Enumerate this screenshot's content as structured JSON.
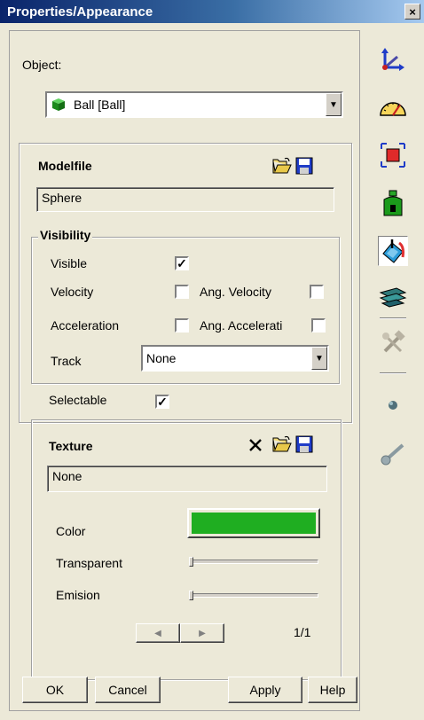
{
  "window": {
    "title": "Properties/Appearance",
    "close_label": "×"
  },
  "object": {
    "label": "Object:",
    "selected": "Ball  [Ball]"
  },
  "modelfile": {
    "title": "Modelfile",
    "value": "Sphere"
  },
  "visibility": {
    "title": "Visibility",
    "visible_label": "Visible",
    "visible_checked": true,
    "velocity_label": "Velocity",
    "velocity_checked": false,
    "ang_velocity_label": "Ang. Velocity",
    "ang_velocity_checked": false,
    "acceleration_label": "Acceleration",
    "acceleration_checked": false,
    "ang_acceleration_label": "Ang. Accelerati",
    "ang_acceleration_checked": false,
    "track_label": "Track",
    "track_value": "None"
  },
  "selectable": {
    "label": "Selectable",
    "checked": true
  },
  "texture": {
    "title": "Texture",
    "value": "None",
    "color_label": "Color",
    "color_value": "#1fae21",
    "transparent_label": "Transparent",
    "transparent_level": 0,
    "emission_label": "Emision",
    "emission_level": 0,
    "page": "1/1"
  },
  "buttons": {
    "ok": "OK",
    "cancel": "Cancel",
    "apply": "Apply",
    "help": "Help"
  },
  "check_glyph": "✓",
  "icons": {
    "toolbar": [
      "axes-icon",
      "speedometer-icon",
      "bounding-box-icon",
      "weight-icon",
      "appearance-paint-icon",
      "layers-icon",
      "tools-icon",
      "point-icon",
      "link-icon"
    ]
  }
}
